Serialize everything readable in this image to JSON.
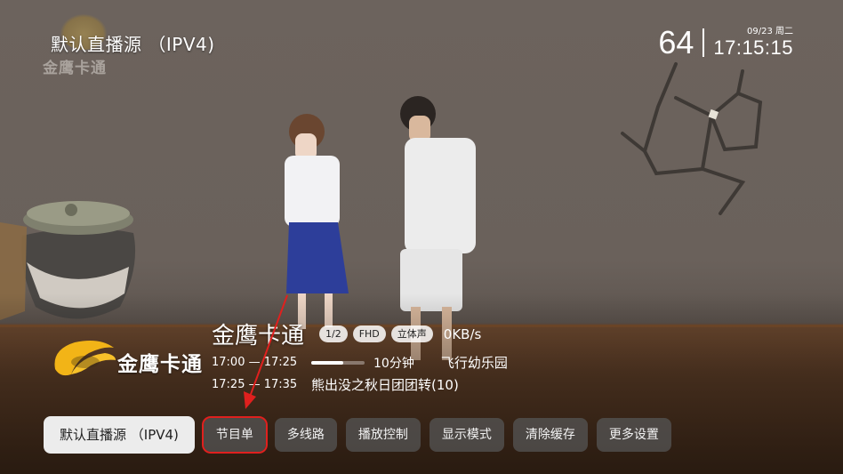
{
  "source": {
    "title": "默认直播源 （IPV4)"
  },
  "watermark": {
    "text": "金鹰卡通"
  },
  "clock": {
    "channel_number": "64",
    "date": "09/23 周二",
    "time": "17:15:15"
  },
  "channel": {
    "logo_text": "金鹰卡通",
    "name": "金鹰卡通",
    "badges": [
      "1/2",
      "FHD",
      "立体声"
    ],
    "speed": "0KB/s"
  },
  "epg": {
    "current": {
      "time": "17:00 — 17:25",
      "progress": 0.6,
      "remaining": "10分钟",
      "title": "飞行幼乐园"
    },
    "next": {
      "time": "17:25 — 17:35",
      "title": "熊出没之秋日团团转(10)"
    }
  },
  "menu": {
    "items": [
      "默认直播源 （IPV4)",
      "节目单",
      "多线路",
      "播放控制",
      "显示模式",
      "清除缓存",
      "更多设置"
    ]
  },
  "colors": {
    "annotation_red": "#e0201e",
    "logo_yellow": "#f2b417"
  }
}
